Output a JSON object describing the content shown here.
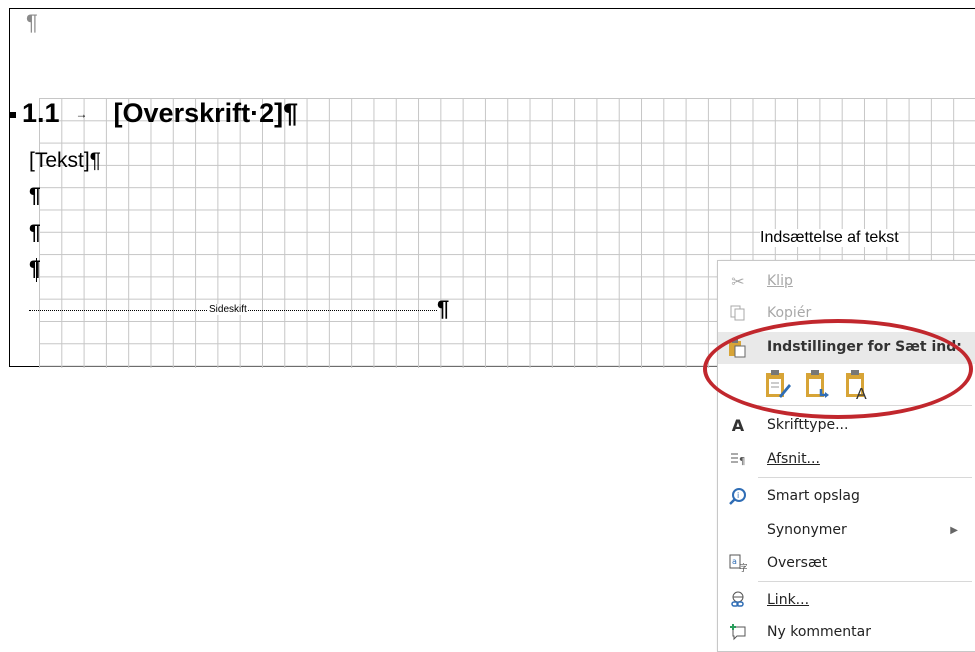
{
  "document": {
    "top_pilcrow": "¶",
    "heading_number": "1.1",
    "heading_tab_arrow": "→",
    "heading_text": "[Overskrift·2]¶",
    "body_lines": [
      "[Tekst]¶",
      "¶",
      "¶",
      "¶"
    ],
    "page_break_label": "Sideskift",
    "page_break_pilcrow": "¶"
  },
  "annotation": "Indsættelse af tekst",
  "context_menu": {
    "cut": "Klip",
    "copy": "Kopiér",
    "paste_options_header": "Indstillinger for Sæt ind:",
    "font": "Skrifttype...",
    "paragraph": "Afsnit...",
    "smart_lookup": "Smart opslag",
    "synonyms": "Synonymer",
    "translate": "Oversæt",
    "link": "Link...",
    "new_comment": "Ny kommentar"
  },
  "icons": {
    "cut": "scissors-icon",
    "copy": "copy-icon",
    "paste": "clipboard-icon",
    "font": "font-icon",
    "paragraph": "paragraph-icon",
    "smart_lookup": "smart-lookup-icon",
    "translate": "translate-icon",
    "link": "link-icon",
    "comment": "comment-icon"
  },
  "colors": {
    "highlight_oval": "#c1272d",
    "icon_gold": "#d7a437",
    "icon_blue": "#2f6db5"
  }
}
